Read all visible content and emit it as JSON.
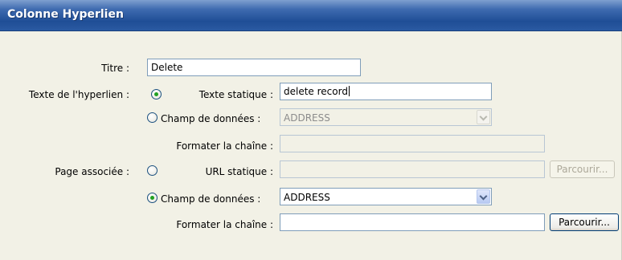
{
  "dialog": {
    "title": "Colonne Hyperlien"
  },
  "form": {
    "titre_label": "Titre :",
    "titre_value": "Delete",
    "texte_hyperlien_label": "Texte de l'hyperlien :",
    "texte_statique_label": "Texte statique :",
    "texte_statique_value": "delete record",
    "texte_hyperlien_selected": "texte-statique",
    "champ_donnees_label_1": "Champ de données :",
    "champ_donnees_value_1": "ADDRESS",
    "formater_label_1": "Formater la chaîne :",
    "formater_value_1": "",
    "page_associee_label": "Page associée :",
    "url_statique_label": "URL statique :",
    "url_statique_value": "",
    "parcourir_label_1": "Parcourir...",
    "page_associee_selected": "champ-de-donnees",
    "champ_donnees_label_2": "Champ de données :",
    "champ_donnees_value_2": "ADDRESS",
    "formater_label_2": "Formater la chaîne :",
    "formater_value_2": "",
    "parcourir_label_2": "Parcourir..."
  },
  "colors": {
    "titlebar": "#2a5aa2",
    "dialog_bg": "#f2f1e6",
    "field_border": "#7f9db9",
    "radio_dot": "#21a121"
  },
  "icons": {
    "dropdown": "chevron-down-icon"
  }
}
